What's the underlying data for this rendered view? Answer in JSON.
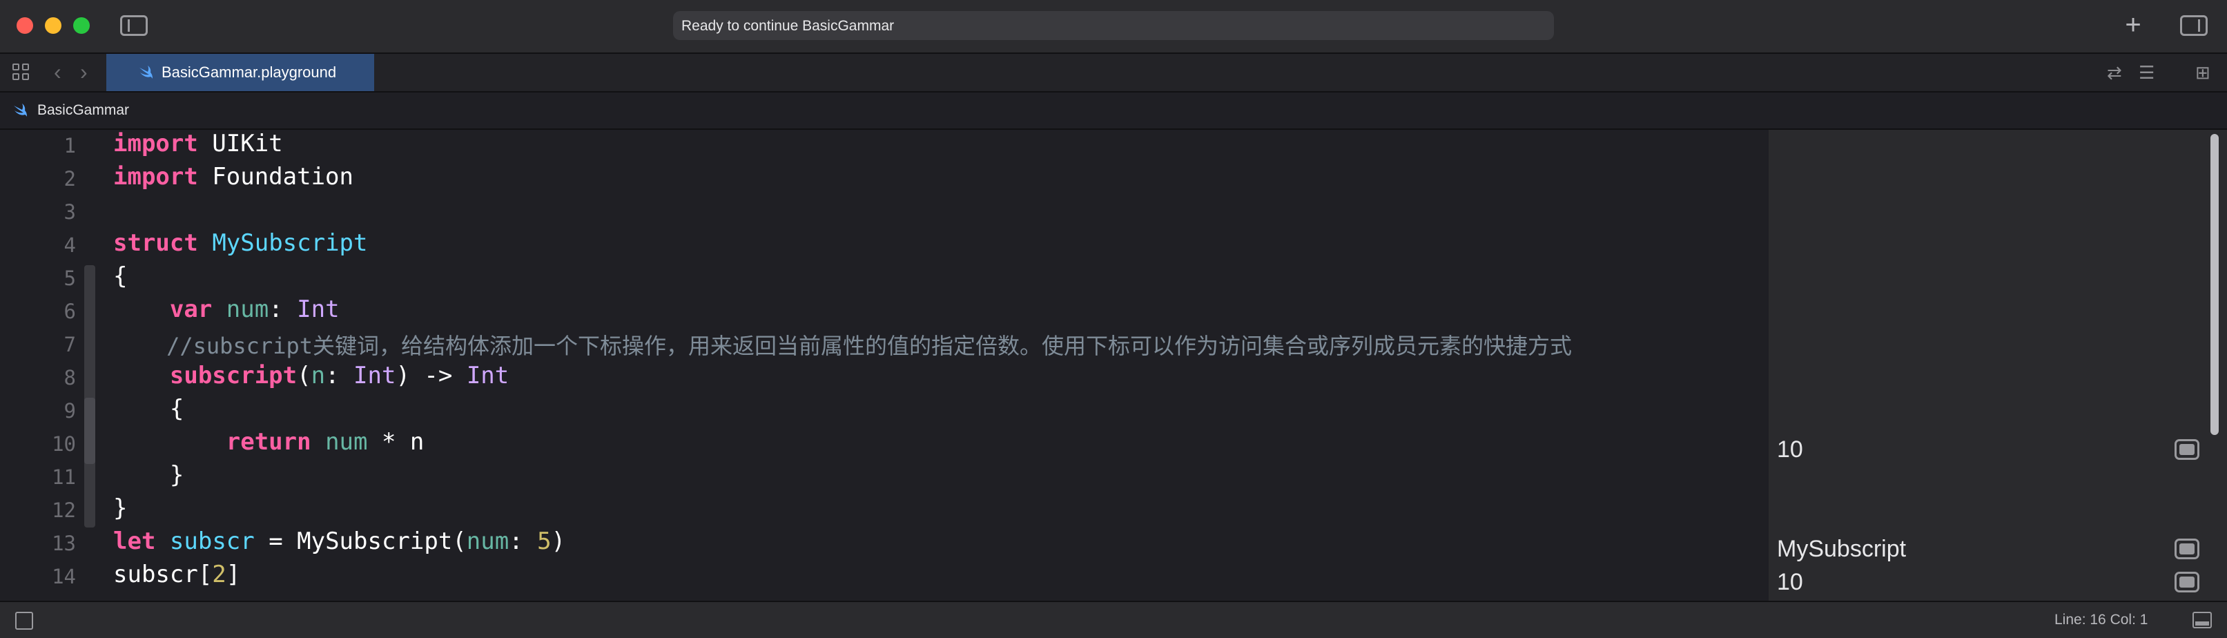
{
  "window": {
    "activity_status": "Ready to continue BasicGammar"
  },
  "tabbar": {
    "active_tab": "BasicGammar.playground"
  },
  "jumpbar": {
    "path": "BasicGammar"
  },
  "editor": {
    "line_numbers": [
      "1",
      "2",
      "3",
      "4",
      "5",
      "6",
      "7",
      "8",
      "9",
      "10",
      "11",
      "12",
      "13",
      "14"
    ],
    "lines": [
      "import UIKit",
      "import Foundation",
      "",
      "struct MySubscript",
      "{",
      "    var num: Int",
      "    //subscript关键词，给结构体添加一个下标操作，用来返回当前属性的值的指定倍数。使用下标可以作为访问集合或序列成员元素的快捷方式",
      "    subscript(n: Int) -> Int",
      "    {",
      "        return num * n",
      "    }",
      "}",
      "let subscr = MySubscript(num: 5)",
      "subscr[2]"
    ]
  },
  "results": {
    "line10": "10",
    "line13": "MySubscript",
    "line14": "10"
  },
  "statusbar": {
    "cursor_position": "Line: 16  Col: 1"
  },
  "icons": {
    "close": "window-close-icon",
    "minimize": "window-minimize-icon",
    "maximize": "window-maximize-icon",
    "navigator": "sidebar-left-icon",
    "library": "plus-icon",
    "inspector": "sidebar-right-icon",
    "swift": "swift-icon",
    "quicklook": "quicklook-icon"
  },
  "colors": {
    "keyword": "#fc5fa3",
    "type_decl": "#5dd8ff",
    "property": "#67b7a4",
    "builtin_type": "#d0a8ff",
    "number": "#d0bf69",
    "comment": "#7f8c98",
    "tab_active": "#2f4d7a"
  }
}
